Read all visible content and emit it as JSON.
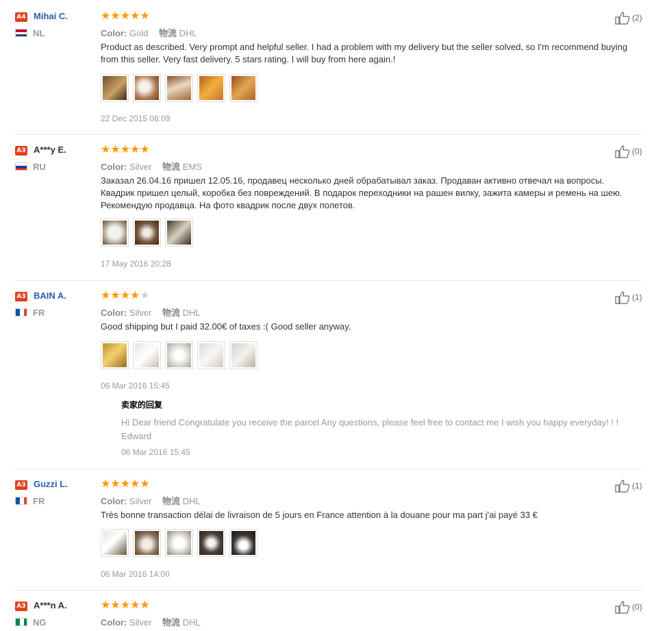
{
  "colors": {
    "accent_star": "#ff9a00",
    "badge": "#e3401d",
    "link": "#2a5db0"
  },
  "labels": {
    "color_label": "Color:",
    "ship_label": "物流",
    "reply_title": "卖家的回复"
  },
  "reviews": [
    {
      "badge": "A4",
      "name": "Mihai C.",
      "country": "NL",
      "flag": "nl",
      "stars": 5,
      "color": "Gold",
      "shipping": "DHL",
      "text": "Product as described. Very prompt and helpful seller. I had a problem with my delivery but the seller solved, so I'm recommend buying from this seller. Very fast delivery. 5 stars rating. I will buy from here again.!",
      "thumbs": [
        "photo-box-gold",
        "photo-drone-parts",
        "photo-parts-box",
        "photo-box-orange",
        "photo-box-gold2"
      ],
      "date": "22 Dec 2015 08:09",
      "likes": "(2)"
    },
    {
      "badge": "A3",
      "name": "A***y E.",
      "country": "RU",
      "flag": "ru",
      "stars": 5,
      "color": "Silver",
      "shipping": "EMS",
      "text": "Заказал 26.04.16 пришел 12.05.16, продавец несколько дней обрабатывал заказ. Продаван активно отвечал на вопросы. Квадрик пришел целый, коробка без повреждений. В подарок переходники на рашен вилку, зажита камеры и ремень на шею. Рекомендую продавца. На фото квадрик после двух полетов.",
      "thumbs": [
        "photo-box-white",
        "photo-drone-table",
        "photo-drone-open"
      ],
      "date": "17 May 2016 20:28",
      "likes": "(0)"
    },
    {
      "badge": "A3",
      "name": "BAIN A.",
      "country": "FR",
      "flag": "fr",
      "stars": 4,
      "color": "Silver",
      "shipping": "DHL",
      "text": "Good shipping but I paid 32.00€ of taxes :( Good seller anyway.",
      "thumbs": [
        "photo-box-gold",
        "photo-box-white",
        "photo-drone-white",
        "photo-box-plain",
        "photo-drone-box"
      ],
      "date": "06 Mar 2016 15:45",
      "likes": "(1)",
      "reply": {
        "text": "Hi Dear friend Congratulate you receive the parcel Any questions, please feel free to contact me I wish you happy everyday! ! ! Edward",
        "date": "06 Mar 2016 15:45"
      }
    },
    {
      "badge": "A3",
      "name": "Guzzi L.",
      "country": "FR",
      "flag": "fr",
      "stars": 5,
      "color": "Silver",
      "shipping": "DHL",
      "text": "Très bonne transaction délai de livraison de 5 jours en France attention à la douane pour ma part j'ai payé 33 €",
      "thumbs": [
        "photo-box-white",
        "photo-drone-parts",
        "photo-drone-white",
        "photo-drone-dark",
        "photo-controller"
      ],
      "date": "06 Mar 2016 14:00",
      "likes": "(1)"
    },
    {
      "badge": "A3",
      "name": "A***n A.",
      "country": "NG",
      "flag": "ng",
      "stars": 5,
      "color": "Silver",
      "shipping": "DHL",
      "likes": "(0)"
    }
  ]
}
